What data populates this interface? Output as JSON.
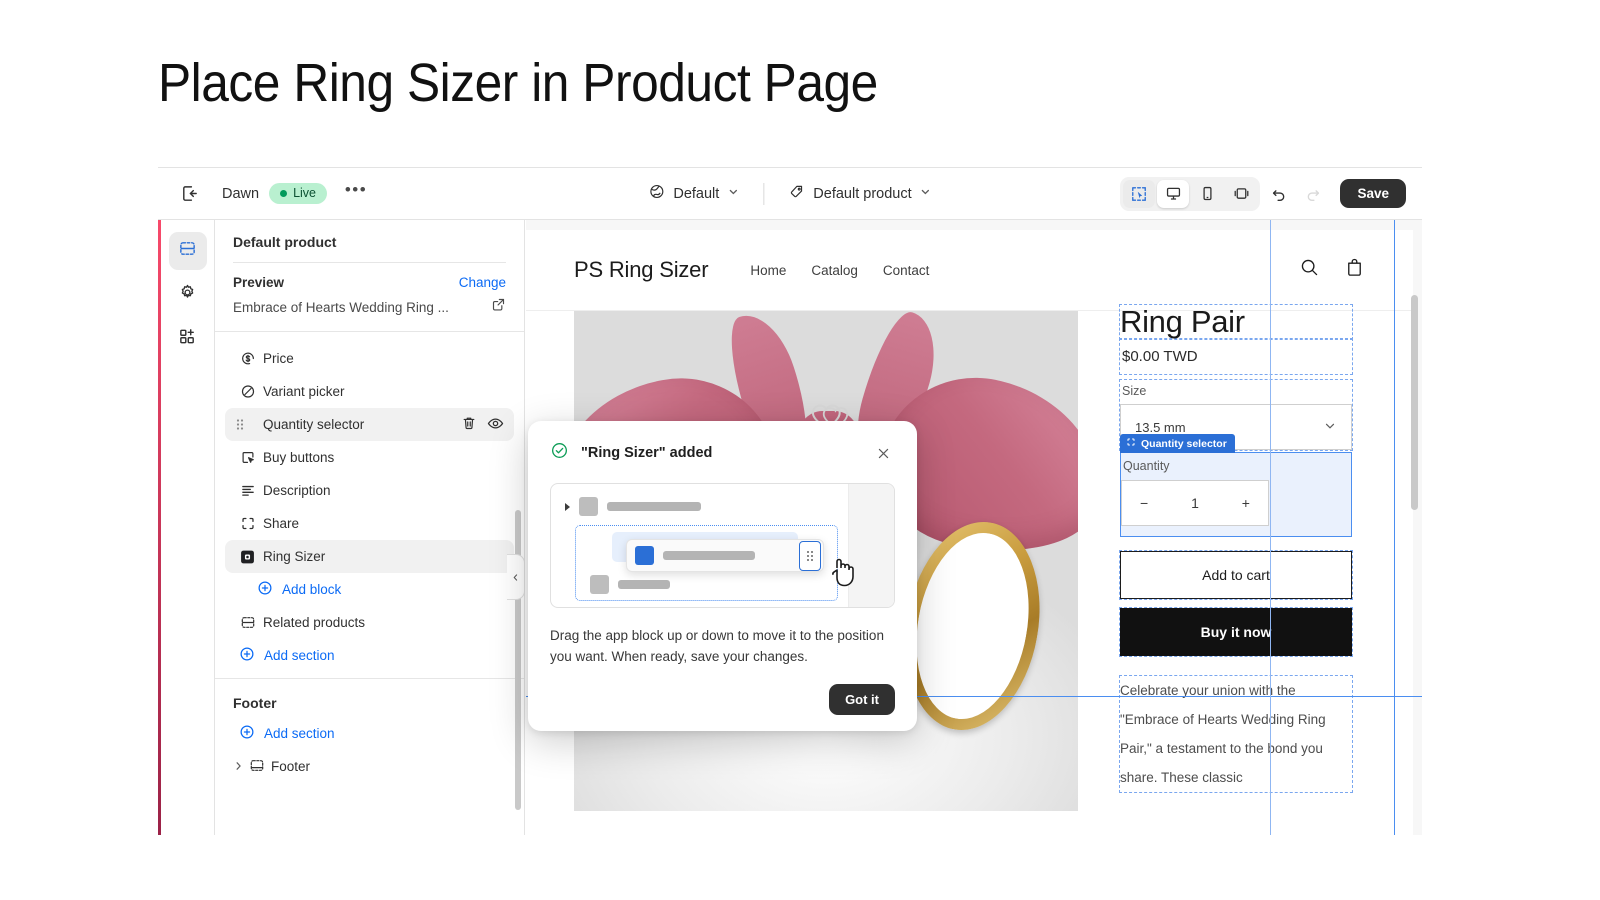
{
  "page": {
    "title": "Place Ring Sizer in Product Page"
  },
  "topbar": {
    "exit_icon": "exit-icon",
    "theme_name": "Dawn",
    "status_badge": "Live",
    "more_label": "•••",
    "locale_selector": {
      "label": "Default",
      "icon": "globe-icon",
      "caret": "chevron-down-icon"
    },
    "template_selector": {
      "label": "Default product",
      "icon": "tag-icon",
      "caret": "chevron-down-icon"
    },
    "tools": [
      {
        "name": "select-tool",
        "icon": "cursor-select-icon",
        "active": true
      },
      {
        "name": "desktop-view",
        "icon": "desktop-icon",
        "active": true
      },
      {
        "name": "mobile-view",
        "icon": "mobile-icon",
        "active": false
      },
      {
        "name": "fullwidth-view",
        "icon": "fullwidth-icon",
        "active": false
      }
    ],
    "undo_icon": "undo-icon",
    "redo_icon": "redo-icon",
    "save_label": "Save"
  },
  "rail": {
    "items": [
      {
        "name": "sections-tab",
        "icon": "sections-icon",
        "active": true
      },
      {
        "name": "settings-tab",
        "icon": "gear-icon",
        "active": false
      },
      {
        "name": "apps-tab",
        "icon": "apps-add-icon",
        "active": false
      }
    ]
  },
  "sidebar": {
    "heading": "Default product",
    "preview": {
      "label": "Preview",
      "change_label": "Change",
      "product_name": "Embrace of Hearts Wedding Ring ...",
      "external_icon": "external-link-icon"
    },
    "blocks": [
      {
        "label": "Price",
        "icon": "price-tag-icon",
        "active": false,
        "draggable": false
      },
      {
        "label": "Variant picker",
        "icon": "variant-icon",
        "active": false,
        "draggable": false
      },
      {
        "label": "Quantity selector",
        "icon": "drag-dots-icon",
        "active": true,
        "draggable": true,
        "actions": [
          {
            "name": "delete-block-button",
            "icon": "trash-icon"
          },
          {
            "name": "hide-block-button",
            "icon": "eye-icon"
          }
        ]
      },
      {
        "label": "Buy buttons",
        "icon": "buy-button-icon",
        "active": false,
        "draggable": false
      },
      {
        "label": "Description",
        "icon": "description-icon",
        "active": false,
        "draggable": false
      },
      {
        "label": "Share",
        "icon": "share-icon",
        "active": false,
        "draggable": false
      },
      {
        "label": "Ring Sizer",
        "icon": "app-block-icon",
        "active": true,
        "draggable": false
      }
    ],
    "add_block_label": "Add block",
    "related_products_label": "Related products",
    "related_products_icon": "section-icon",
    "add_section_label": "Add section",
    "footer_heading": "Footer",
    "footer_add_section_label": "Add section",
    "footer_item_label": "Footer",
    "footer_item_icon": "footer-section-icon"
  },
  "store_preview": {
    "logo": "PS Ring Sizer",
    "nav": [
      "Home",
      "Catalog",
      "Contact"
    ],
    "header_icons": [
      {
        "name": "search-icon"
      },
      {
        "name": "cart-icon"
      }
    ],
    "product": {
      "title": "Ring Pair",
      "price": "$0.00 TWD",
      "size_label": "Size",
      "size_value": "13.5 mm",
      "size_caret": "chevron-down-icon",
      "quantity_badge": "Quantity selector",
      "quantity_badge_icon": "block-select-icon",
      "quantity_label": "Quantity",
      "quantity_minus": "−",
      "quantity_value": "1",
      "quantity_plus": "+",
      "add_to_cart_label": "Add to cart",
      "buy_now_label": "Buy it now",
      "description": "Celebrate your union with the \"Embrace of Hearts Wedding Ring Pair,\" a testament to the bond you share. These classic"
    }
  },
  "modal": {
    "success_icon": "check-circle-icon",
    "title": "\"Ring Sizer\" added",
    "close_icon": "close-icon",
    "illustration": {
      "cursor_icon": "drag-hand-cursor-icon",
      "handle_icon": "drag-handle-icon"
    },
    "body": "Drag the app block up or down to move it to the position you want. When ready, save your changes.",
    "primary_button": "Got it"
  },
  "colors": {
    "accent_blue": "#2b6fd6",
    "link_blue": "#0c6bf5",
    "live_badge_bg": "#b9f0d0",
    "live_badge_fg": "#0c5132",
    "dark_button": "#303030",
    "success_green": "#029a5b"
  }
}
